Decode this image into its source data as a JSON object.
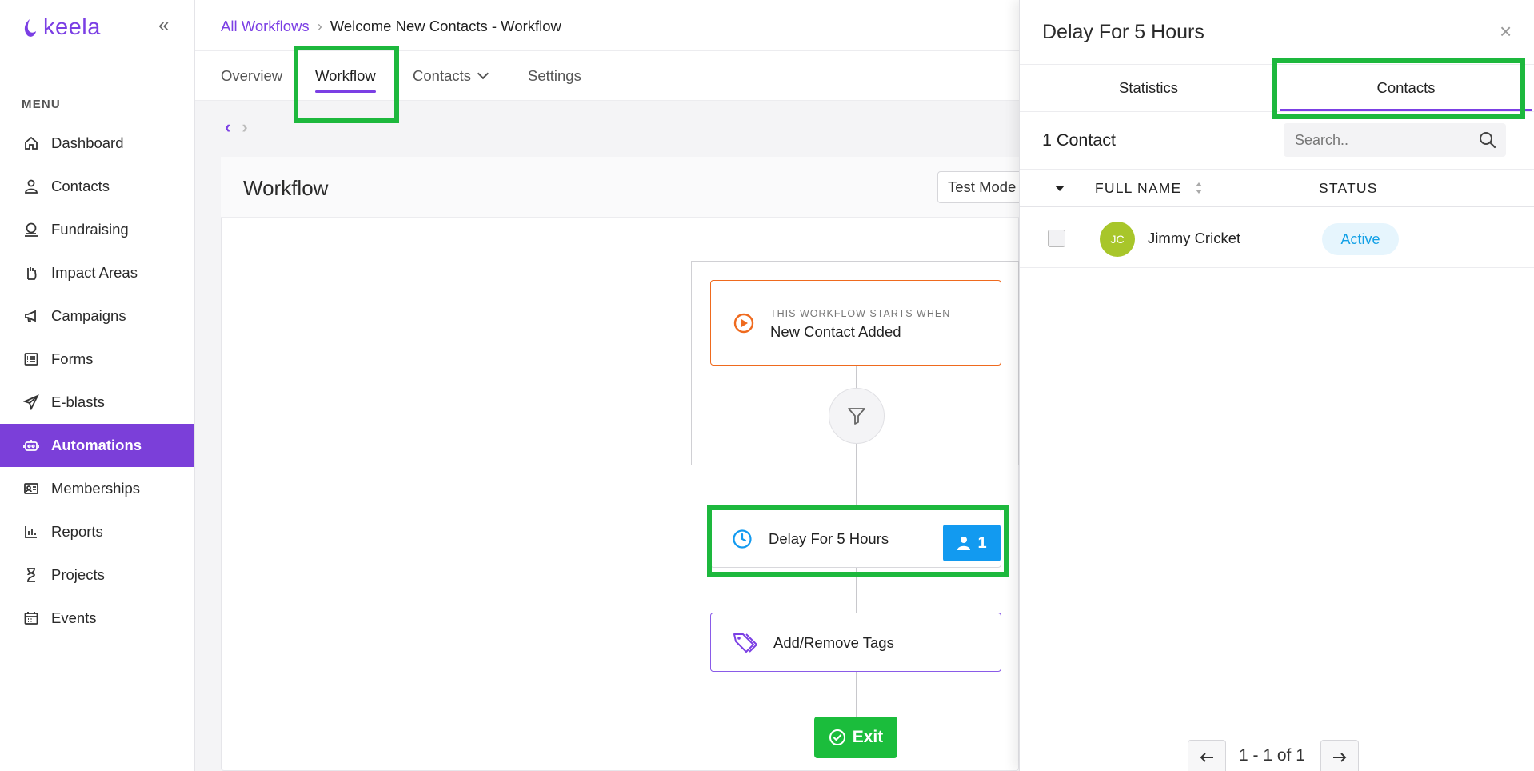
{
  "brand": {
    "name": "keela",
    "accent": "#7b3fe4"
  },
  "sidebar": {
    "collapse_icon": "double-chevron-left-icon",
    "menu_label": "MENU",
    "items": [
      {
        "label": "Dashboard",
        "icon": "home-icon"
      },
      {
        "label": "Contacts",
        "icon": "user-icon"
      },
      {
        "label": "Fundraising",
        "icon": "donation-icon"
      },
      {
        "label": "Impact Areas",
        "icon": "hand-icon"
      },
      {
        "label": "Campaigns",
        "icon": "megaphone-icon"
      },
      {
        "label": "Forms",
        "icon": "list-icon"
      },
      {
        "label": "E-blasts",
        "icon": "paper-plane-icon"
      },
      {
        "label": "Automations",
        "icon": "robot-icon",
        "active": true
      },
      {
        "label": "Memberships",
        "icon": "id-card-icon"
      },
      {
        "label": "Reports",
        "icon": "bar-chart-icon"
      },
      {
        "label": "Projects",
        "icon": "hourglass-icon"
      },
      {
        "label": "Events",
        "icon": "calendar-icon"
      }
    ]
  },
  "breadcrumb": {
    "root": "All Workflows",
    "current": "Welcome New Contacts - Workflow"
  },
  "tabs": {
    "overview": "Overview",
    "workflow": "Workflow",
    "contacts": "Contacts",
    "settings": "Settings"
  },
  "workflow": {
    "title": "Workflow",
    "test_mode": "Test Mode",
    "trigger_small": "THIS WORKFLOW STARTS WHEN",
    "trigger_label": "New Contact Added",
    "delay_label": "Delay For 5 Hours",
    "delay_count": "1",
    "tags_label": "Add/Remove Tags",
    "exit_label": "Exit"
  },
  "drawer": {
    "title": "Delay For 5 Hours",
    "close": "×",
    "tab_statistics": "Statistics",
    "tab_contacts": "Contacts",
    "count_label": "1 Contact",
    "search_placeholder": "Search..",
    "col_full_name": "FULL NAME",
    "col_status": "STATUS",
    "rows": [
      {
        "initials": "JC",
        "name": "Jimmy Cricket",
        "status": "Active"
      }
    ],
    "pagination": "1 - 1 of 1"
  },
  "colors": {
    "highlight": "#1db83d",
    "trigger": "#ef6a1e",
    "badge": "#129af0",
    "exit": "#1bbd3c"
  }
}
